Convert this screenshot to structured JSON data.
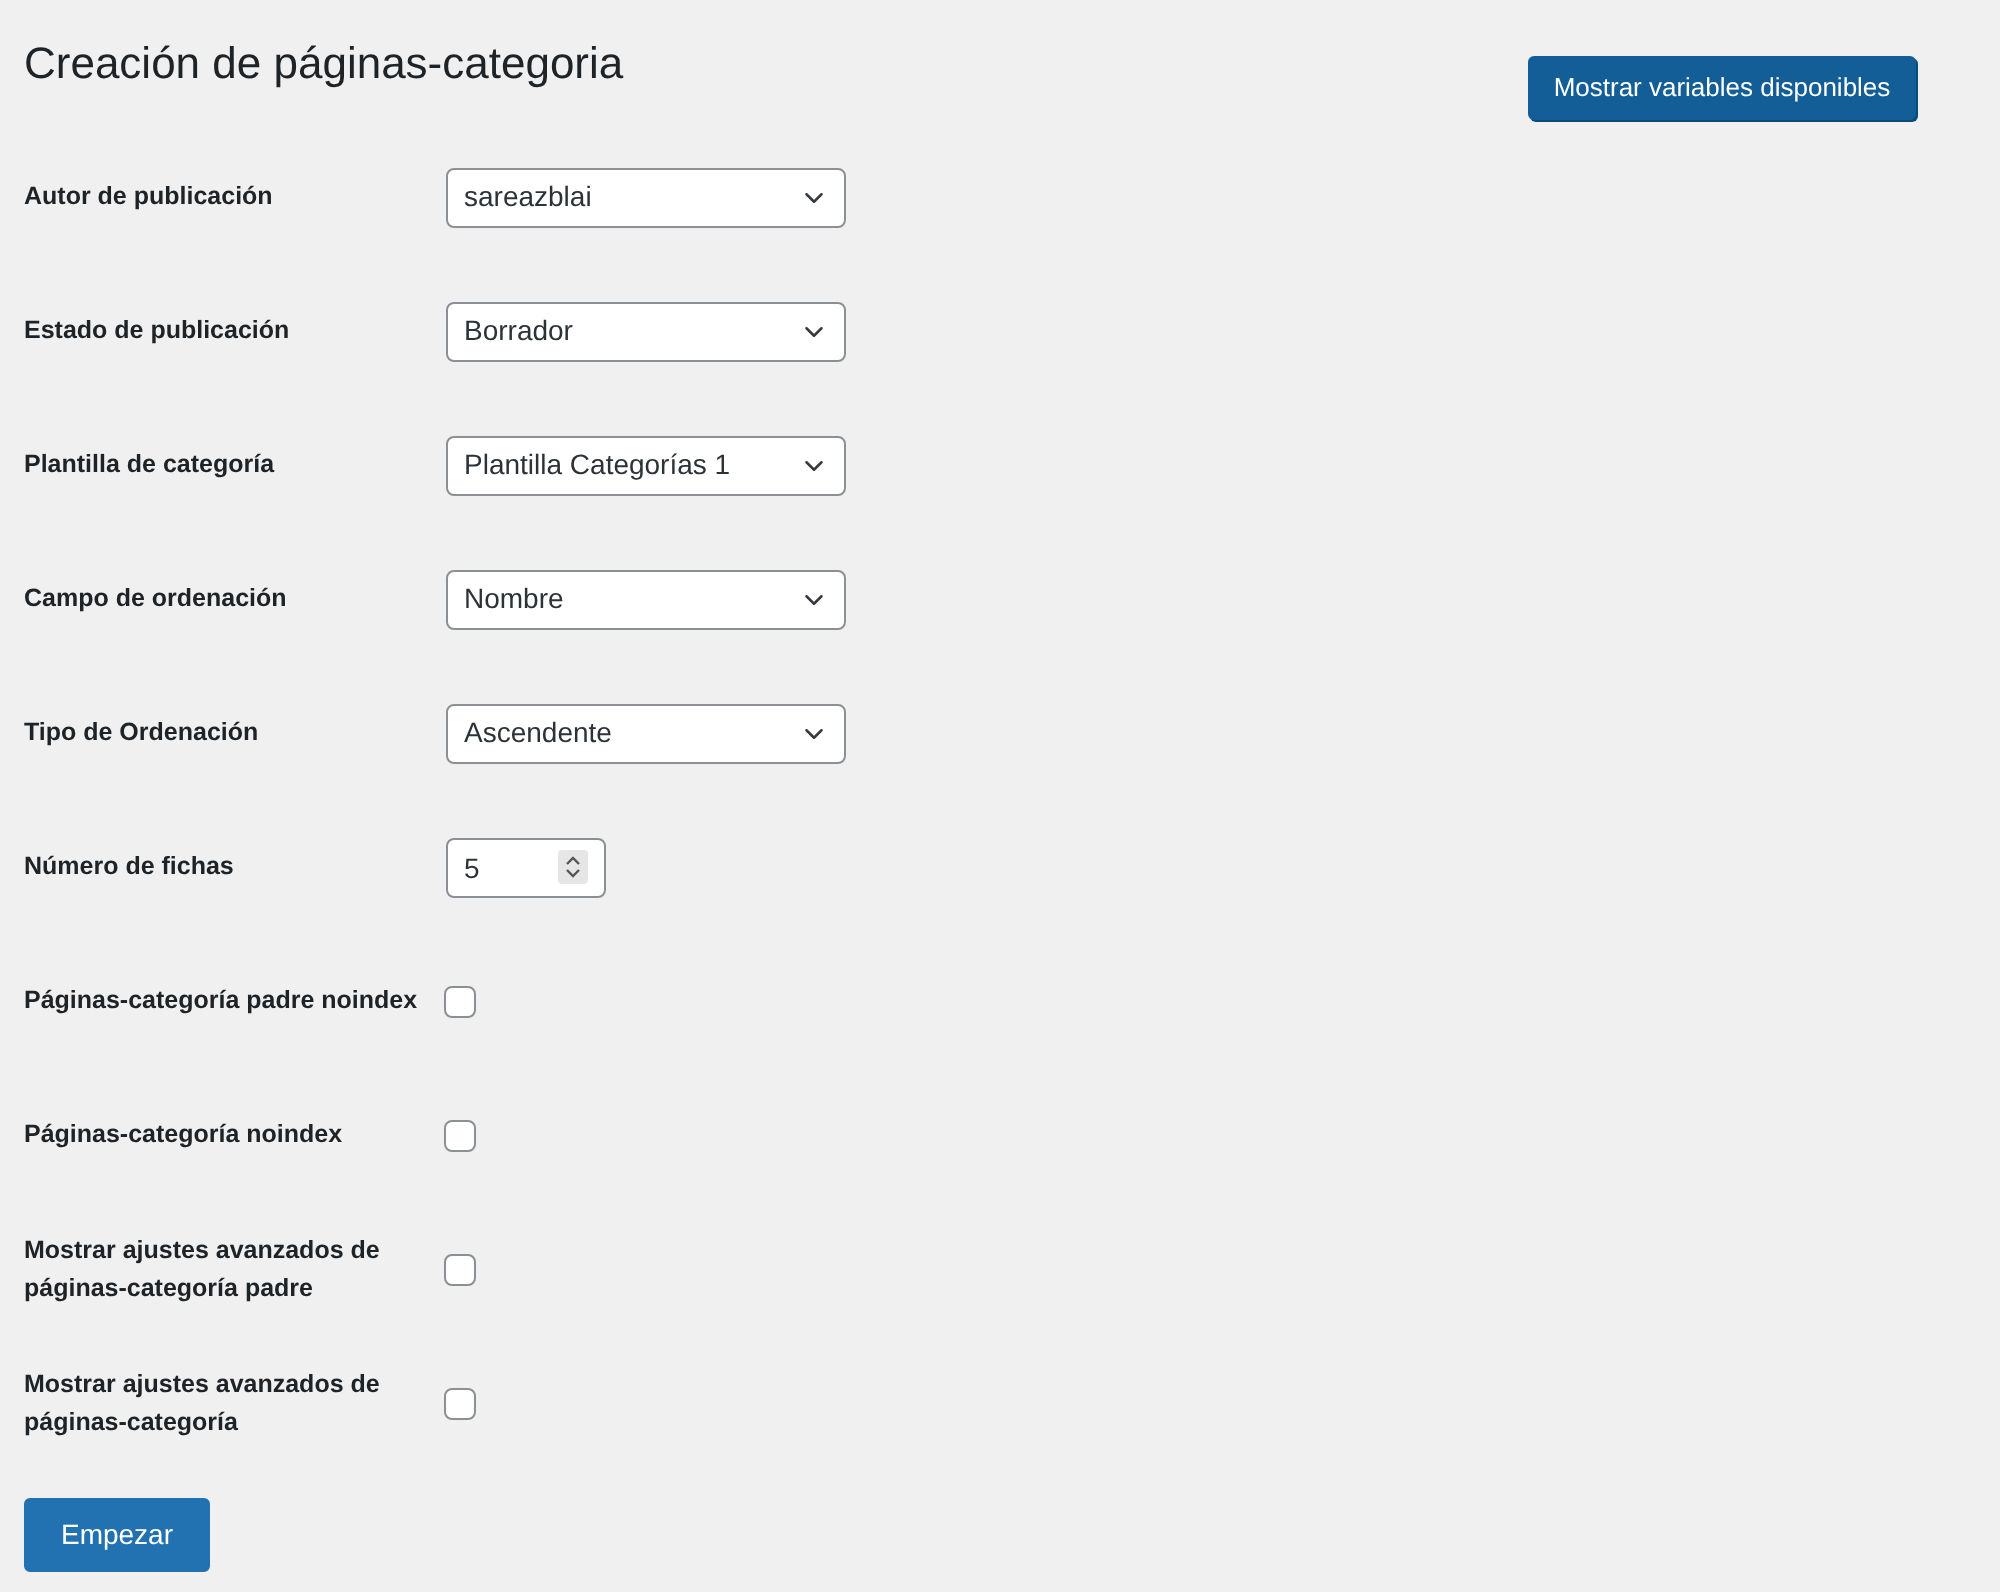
{
  "title": "Creación de páginas-categoria",
  "variables_button": "Mostrar variables disponibles",
  "fields": [
    {
      "label": "Autor de publicación",
      "kind": "select",
      "value": "sareazblai"
    },
    {
      "label": "Estado de publicación",
      "kind": "select",
      "value": "Borrador"
    },
    {
      "label": "Plantilla de categoría",
      "kind": "select",
      "value": "Plantilla Categorías 1"
    },
    {
      "label": "Campo de ordenación",
      "kind": "select",
      "value": "Nombre"
    },
    {
      "label": "Tipo de Ordenación",
      "kind": "select",
      "value": "Ascendente"
    },
    {
      "label": "Número de fichas",
      "kind": "number",
      "value": "5"
    },
    {
      "label": "Páginas-categoría padre noindex",
      "kind": "checkbox",
      "checked": false
    },
    {
      "label": "Páginas-categoría noindex",
      "kind": "checkbox",
      "checked": false
    },
    {
      "label": "Mostrar ajustes avanzados de páginas-categoría padre",
      "kind": "checkbox",
      "checked": false
    },
    {
      "label": "Mostrar ajustes avanzados de páginas-categoría",
      "kind": "checkbox",
      "checked": false
    }
  ],
  "submit_button": "Empezar"
}
